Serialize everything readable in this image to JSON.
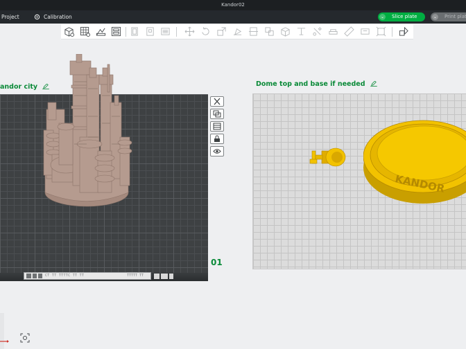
{
  "window": {
    "title": "Kandor02"
  },
  "menubar": {
    "items": [
      {
        "label": "Project",
        "icon": "project-icon"
      },
      {
        "label": "Calibration",
        "icon": "calibration-icon"
      }
    ],
    "slice_button": "Slice plate",
    "print_button": "Print plate"
  },
  "toolbar": {
    "tools": [
      "add-object-icon",
      "add-plate-icon",
      "auto-orient-icon",
      "arrange-icon",
      "copy-icon",
      "paste-icon",
      "list-icon",
      "move-icon",
      "rotate-icon",
      "scale-icon",
      "lay-on-face-icon",
      "cut-icon",
      "split-icon",
      "boolean-icon",
      "support-paint-icon",
      "seam-paint-icon",
      "color-paint-icon",
      "measure-icon",
      "text-icon",
      "fit-icon",
      "variable-layer-icon"
    ]
  },
  "plates": [
    {
      "name": "andor city",
      "number": "01",
      "label_text": "CT TT TTTTC TT TT",
      "label_num": "TTTTT TT"
    },
    {
      "name": "Dome top and base if needed"
    }
  ],
  "plate_side_buttons": [
    "remove-plate-icon",
    "arrange-plate-icon",
    "plate-settings-icon",
    "lock-plate-icon",
    "view-plate-icon"
  ],
  "model": {
    "base_text": "KANDOR"
  },
  "colors": {
    "accent": "#00ae42",
    "title_green": "#0a8a38",
    "model_city": "#b59b8f",
    "model_dome": "#f2c200"
  }
}
